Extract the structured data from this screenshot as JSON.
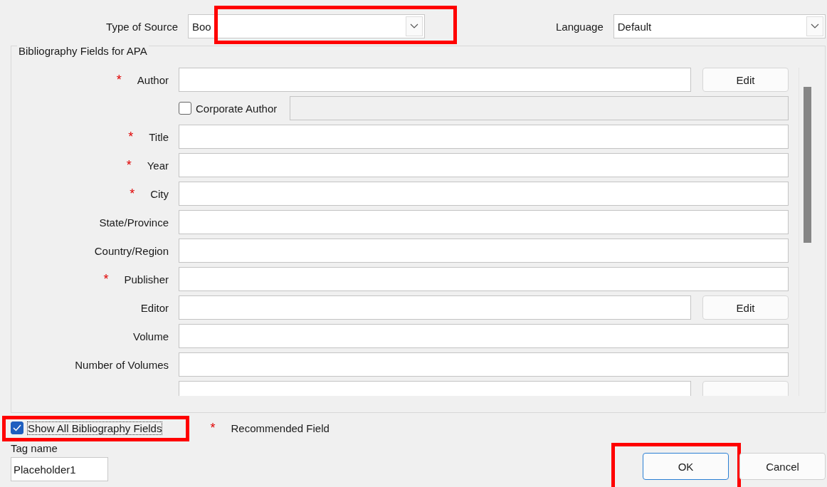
{
  "type_of_source": {
    "label": "Type of Source",
    "value": "Boo",
    "highlighted": true
  },
  "language": {
    "label": "Language",
    "value": "Default"
  },
  "group": {
    "title": "Bibliography Fields for APA"
  },
  "fields": [
    {
      "kind": "editable",
      "marker": "*",
      "label": "Author",
      "button": "Edit"
    },
    {
      "kind": "checkbox",
      "label": "Corporate Author",
      "checked": false
    },
    {
      "kind": "text",
      "marker": "*",
      "label": "Title"
    },
    {
      "kind": "text",
      "marker": "*",
      "label": "Year"
    },
    {
      "kind": "text",
      "marker": "*",
      "label": "City"
    },
    {
      "kind": "text",
      "label": "State/Province"
    },
    {
      "kind": "text",
      "label": "Country/Region"
    },
    {
      "kind": "text",
      "marker": "*",
      "label": "Publisher"
    },
    {
      "kind": "editable",
      "label": "Editor",
      "button": "Edit"
    },
    {
      "kind": "text",
      "label": "Volume"
    },
    {
      "kind": "text",
      "label": "Number of Volumes"
    },
    {
      "kind": "editable"
    }
  ],
  "show_all": {
    "label": "Show All Bibliography Fields",
    "checked": true,
    "highlighted": true
  },
  "legend": {
    "marker": "*",
    "label": "Recommended Field"
  },
  "tag_name": {
    "label": "Tag name",
    "value": "Placeholder1"
  },
  "buttons": [
    {
      "label": "OK",
      "kind": "default",
      "highlighted": true
    },
    {
      "label": "Cancel",
      "kind": "normal",
      "highlighted": false
    }
  ]
}
